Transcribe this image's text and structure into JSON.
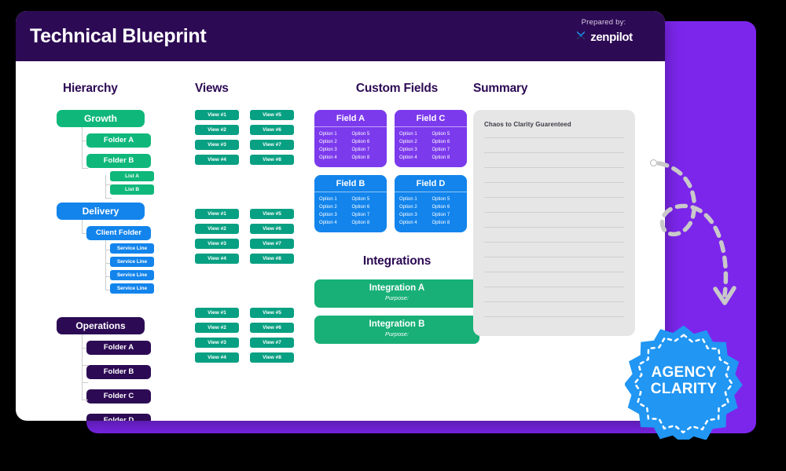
{
  "header": {
    "title": "Technical Blueprint",
    "prepared_label": "Prepared by:",
    "brand_name": "zenpilot",
    "bg_color": "#2d0a54"
  },
  "colors": {
    "page_bg": "#000000",
    "slab_purple": "#7c26ec",
    "card_white": "#ffffff",
    "green": "#0fb87a",
    "teal": "#08a082",
    "blue": "#1284ec",
    "deep_purple": "#2d0a54",
    "field_purple": "#7c3aed",
    "integration_green": "#18b077",
    "badge_blue": "#2196f3",
    "summary_gray": "#e6e6e6"
  },
  "hierarchy": {
    "heading": "Hierarchy",
    "groups": [
      {
        "root": "Growth",
        "color": "green",
        "children": [
          {
            "label": "Folder A",
            "leaves": []
          },
          {
            "label": "Folder B",
            "leaves": [
              "List A",
              "List B"
            ]
          }
        ]
      },
      {
        "root": "Delivery",
        "color": "blue",
        "children": [
          {
            "label": "Client Folder",
            "leaves": [
              "Service Line",
              "Service Line",
              "Service Line",
              "Service Line"
            ]
          }
        ]
      },
      {
        "root": "Operations",
        "color": "purple",
        "children": [
          {
            "label": "Folder A",
            "leaves": []
          },
          {
            "label": "Folder B",
            "leaves": []
          },
          {
            "label": "Folder C",
            "leaves": []
          },
          {
            "label": "Folder D",
            "leaves": []
          }
        ]
      }
    ]
  },
  "views": {
    "heading": "Views",
    "blocks": [
      {
        "items": [
          "View #1",
          "View #5",
          "View #2",
          "View #6",
          "View #3",
          "View #7",
          "View #4",
          "View #8"
        ]
      },
      {
        "items": [
          "View #1",
          "View #5",
          "View #2",
          "View #6",
          "View #3",
          "View #7",
          "View #4",
          "View #8"
        ]
      },
      {
        "items": [
          "View #1",
          "View #5",
          "View #2",
          "View #6",
          "View #3",
          "View #7",
          "View #4",
          "View #8"
        ]
      }
    ]
  },
  "custom_fields": {
    "heading": "Custom Fields",
    "cards": [
      {
        "title": "Field A",
        "color": "purple",
        "options": [
          "Option 1",
          "Option 5",
          "Option 2",
          "Option 6",
          "Option 3",
          "Option 7",
          "Option 4",
          "Option 8"
        ]
      },
      {
        "title": "Field C",
        "color": "purple",
        "options": [
          "Option 1",
          "Option 5",
          "Option 2",
          "Option 6",
          "Option 3",
          "Option 7",
          "Option 4",
          "Option 8"
        ]
      },
      {
        "title": "Field B",
        "color": "blue",
        "options": [
          "Option 1",
          "Option 5",
          "Option 2",
          "Option 6",
          "Option 3",
          "Option 7",
          "Option 4",
          "Option 8"
        ]
      },
      {
        "title": "Field D",
        "color": "blue",
        "options": [
          "Option 1",
          "Option 5",
          "Option 2",
          "Option 6",
          "Option 3",
          "Option 7",
          "Option 4",
          "Option 8"
        ]
      }
    ]
  },
  "integrations": {
    "heading": "Integrations",
    "items": [
      {
        "name": "Integration A",
        "purpose": "Purpose:"
      },
      {
        "name": "Integration B",
        "purpose": "Purpose:"
      }
    ]
  },
  "summary": {
    "heading": "Summary",
    "lead_text": "Chaos to Clarity Guarenteed",
    "line_count": 13
  },
  "badge": {
    "line1": "AGENCY",
    "line2": "CLARITY"
  }
}
